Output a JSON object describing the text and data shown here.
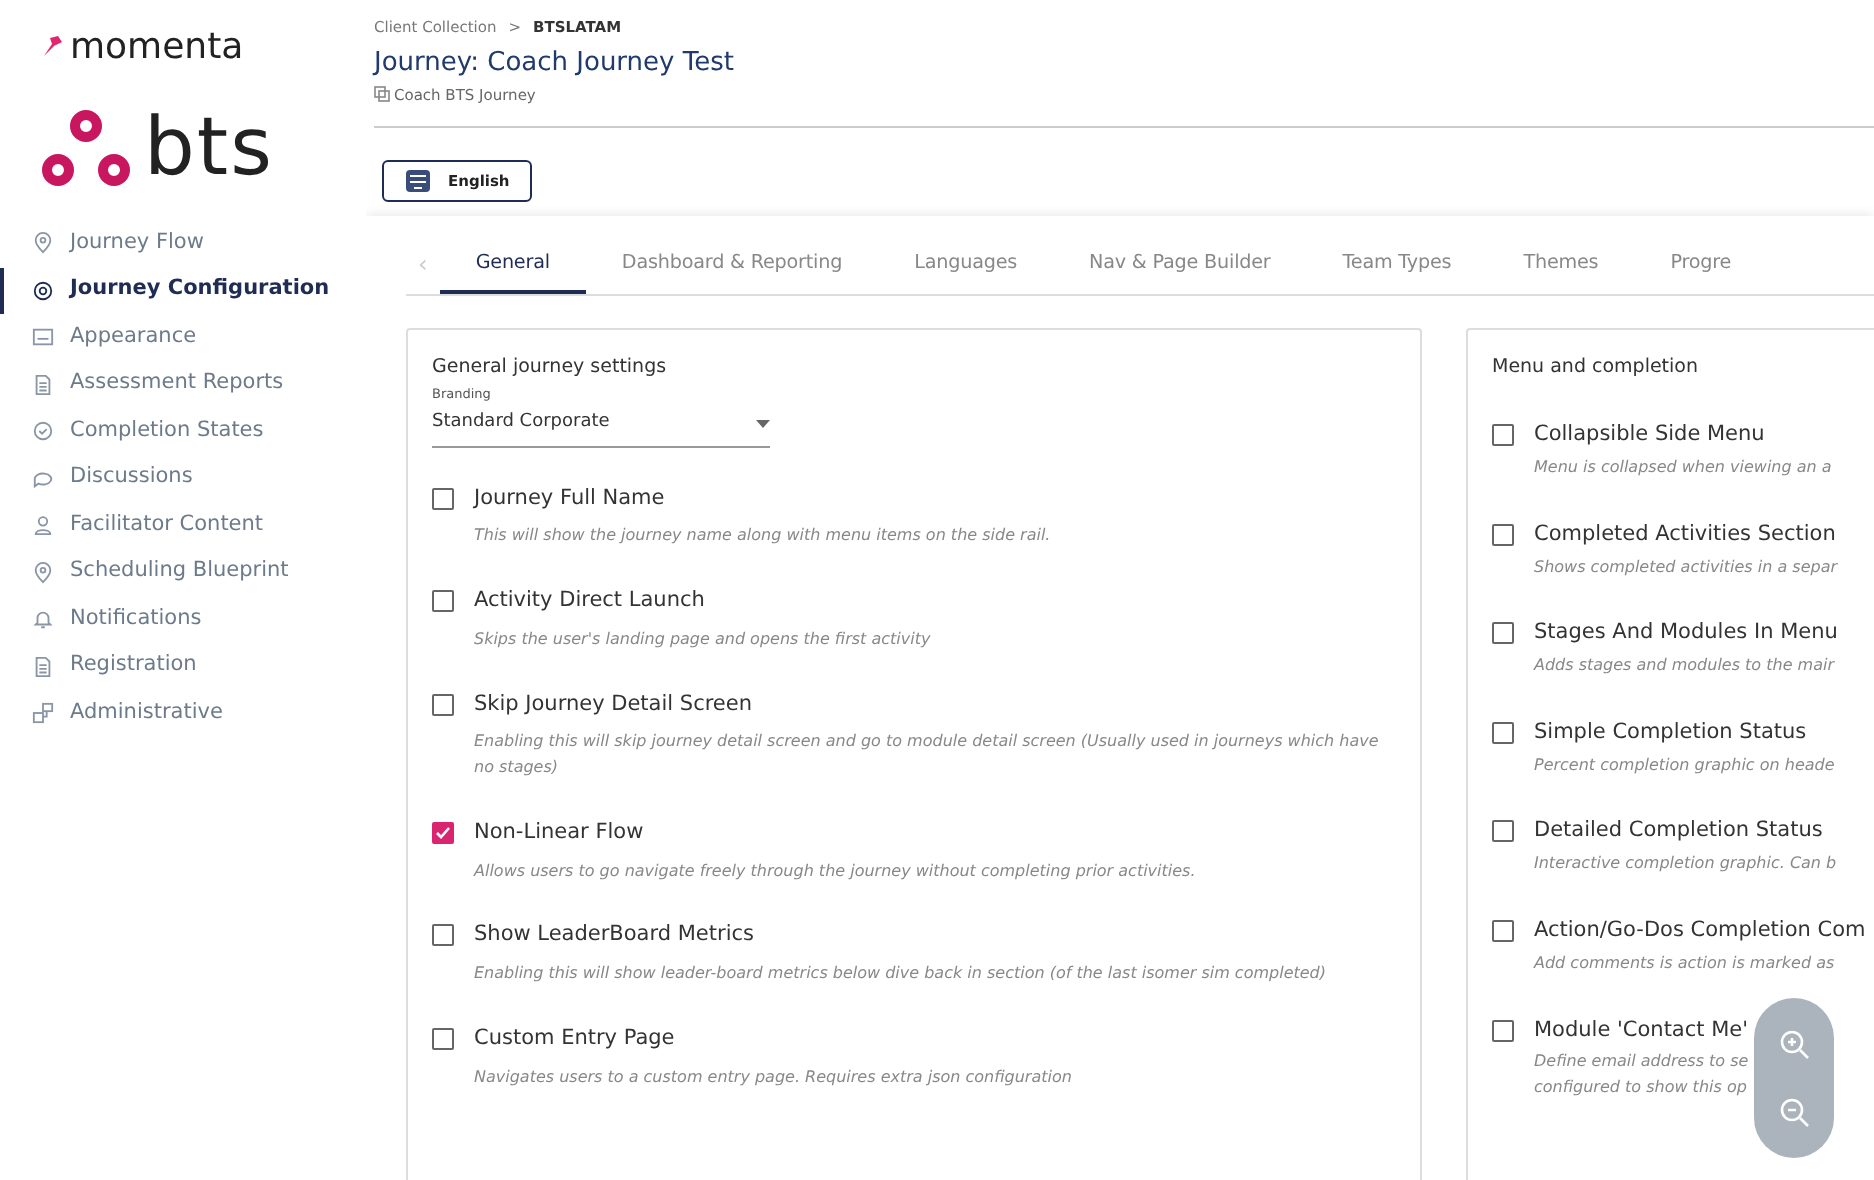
{
  "brand": {
    "product": "momenta",
    "company": "bts"
  },
  "sidebar": {
    "items": [
      {
        "label": "Journey Flow",
        "selected": false
      },
      {
        "label": "Journey Configuration",
        "selected": true
      },
      {
        "label": "Appearance",
        "selected": false
      },
      {
        "label": "Assessment Reports",
        "selected": false
      },
      {
        "label": "Completion States",
        "selected": false
      },
      {
        "label": "Discussions",
        "selected": false
      },
      {
        "label": "Facilitator Content",
        "selected": false
      },
      {
        "label": "Scheduling Blueprint",
        "selected": false
      },
      {
        "label": "Notifications",
        "selected": false
      },
      {
        "label": "Registration",
        "selected": false
      },
      {
        "label": "Administrative",
        "selected": false
      }
    ]
  },
  "breadcrumb": [
    "Client Collection",
    ">",
    "BTSLATAM"
  ],
  "title": "Journey: Coach Journey Test",
  "subtitle": "Coach BTS Journey",
  "language_button": "English",
  "tabs_prev": "‹",
  "tabs": [
    {
      "label": "General",
      "selected": true
    },
    {
      "label": "Dashboard & Reporting",
      "selected": false
    },
    {
      "label": "Languages",
      "selected": false
    },
    {
      "label": "Nav & Page Builder",
      "selected": false
    },
    {
      "label": "Team Types",
      "selected": false
    },
    {
      "label": "Themes",
      "selected": false
    },
    {
      "label": "Progre",
      "selected": false
    }
  ],
  "general_settings": {
    "heading": "General journey settings",
    "branding_label": "Branding",
    "branding_value": "Standard Corporate",
    "options": [
      {
        "label": "Journey Full Name",
        "description": "This will show the journey name along with menu items on the side rail.",
        "checked": false
      },
      {
        "label": "Activity Direct Launch",
        "description": "Skips the user's landing page and opens the first activity",
        "checked": false
      },
      {
        "label": "Skip Journey Detail Screen",
        "description": "Enabling this will skip journey detail screen and go to module detail screen (Usually used in journeys which have no stages)",
        "checked": false
      },
      {
        "label": "Non-Linear Flow",
        "description": "Allows users to go navigate freely through the journey without completing prior activities.",
        "checked": true
      },
      {
        "label": "Show LeaderBoard Metrics",
        "description": "Enabling this will show leader-board metrics below dive back in section (of the last isomer sim completed)",
        "checked": false
      },
      {
        "label": "Custom Entry Page",
        "description": "Navigates users to a custom entry page. Requires extra json configuration",
        "checked": false
      }
    ]
  },
  "menu_completion": {
    "heading": "Menu and completion",
    "options": [
      {
        "label": "Collapsible Side Menu",
        "description": "Menu is collapsed when viewing an a",
        "checked": false
      },
      {
        "label": "Completed Activities Section",
        "description": "Shows completed activities in a separ",
        "checked": false
      },
      {
        "label": "Stages And Modules In Menu",
        "description": "Adds stages and modules to the mair",
        "checked": false
      },
      {
        "label": "Simple Completion Status",
        "description": "Percent completion graphic on heade",
        "checked": false
      },
      {
        "label": "Detailed Completion Status",
        "description": "Interactive completion graphic. Can b",
        "checked": false
      },
      {
        "label": "Action/Go-Dos Completion Com",
        "description": "Add comments is action is marked as",
        "checked": false
      },
      {
        "label": "Module 'Contact Me'",
        "description": "Define email address to se",
        "description_2": "configured to show this op",
        "checked": false
      }
    ]
  }
}
